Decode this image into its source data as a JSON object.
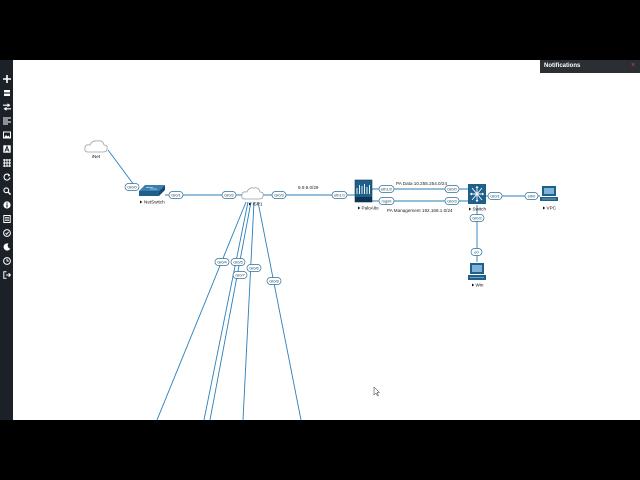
{
  "sidebar": {
    "icons": [
      "add-object-icon",
      "nodes-icon",
      "networks-icon",
      "startup-configs-icon",
      "pictures-icon",
      "text-icon",
      "lab-details-icon",
      "refresh-icon",
      "zoom-icon",
      "status-icon",
      "list-icon",
      "lock-icon",
      "dark-mode-icon",
      "time-icon",
      "logout-icon"
    ]
  },
  "notifications": {
    "title": "Notifications",
    "close": "×"
  },
  "topology": {
    "nodes": {
      "inet": "iNet",
      "netswitch": "NetSwitch",
      "isp1": "ISP1",
      "paloalto": "PaloAlto",
      "switch": "Switch",
      "vpc": "VPC",
      "win": "Win"
    },
    "networks": {
      "isp_subnet": "9.9.9.0/29",
      "pa_data": "PA Data 10.255.254.0/24",
      "pa_mgmt": "PA Management 192.168.1.0/24"
    },
    "interfaces": {
      "netswitch_up": "Gi0/0",
      "netswitch_right": "Gi0/1",
      "isp1_left": "Gi0/2",
      "isp1_right": "Gi0/3",
      "isp1_down1": "Gi0/4",
      "isp1_down2": "Gi0/5",
      "isp1_down3": "Gi0/6",
      "isp1_down4": "Gi0/7",
      "isp1_down5": "Gi0/8",
      "pa_left": "eth1/1",
      "pa_data": "eth1/2",
      "pa_mgmt": "mgmt",
      "sw_data": "Gi0/0",
      "sw_mgmt": "Gi0/3",
      "sw_vpc": "Gi0/1",
      "sw_down": "Gi0/2",
      "vpc": "eth0",
      "win": "e0"
    }
  },
  "colors": {
    "sidebar_bg": "#1c2127",
    "canvas_bg": "#ffffff",
    "link": "#2a7fba",
    "device": "#1f5f8b",
    "notification_header": "#2b2f33",
    "close": "#e23b3b"
  }
}
